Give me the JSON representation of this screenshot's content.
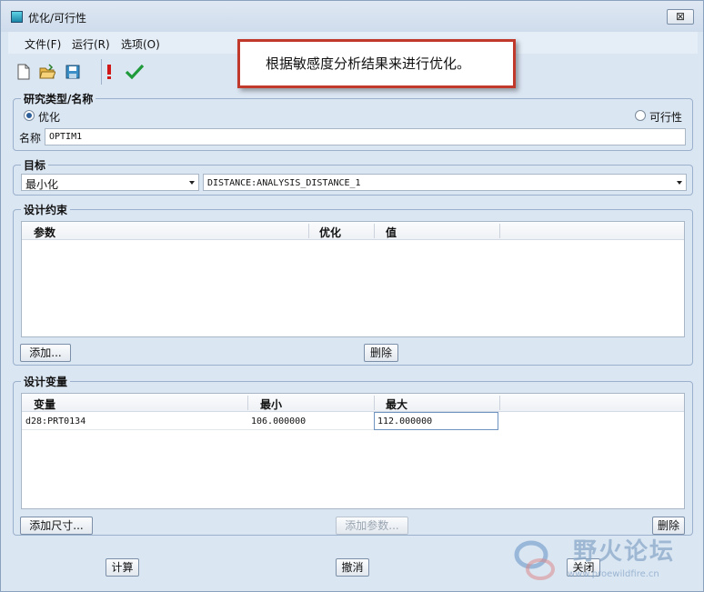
{
  "window": {
    "title": "优化/可行性",
    "close_label": "⊠"
  },
  "menu": [
    "文件(F)",
    "运行(R)",
    "选项(O)"
  ],
  "callout": "根据敏感度分析结果来进行优化。",
  "study": {
    "group_label": "研究类型/名称",
    "option_optimize": "优化",
    "option_feasible": "可行性",
    "selected": "优化",
    "name_label": "名称",
    "name_value": "OPTIM1"
  },
  "goal": {
    "group_label": "目标",
    "mode": "最小化",
    "measure": "DISTANCE:ANALYSIS_DISTANCE_1"
  },
  "constraints": {
    "group_label": "设计约束",
    "columns": [
      "参数",
      "优化",
      "值"
    ],
    "rows": [],
    "add_button": "添加...",
    "delete_button": "删除"
  },
  "variables": {
    "group_label": "设计变量",
    "columns": [
      "变量",
      "最小",
      "最大"
    ],
    "rows": [
      {
        "variable": "d28:PRT0134",
        "min": "106.000000",
        "max": "112.000000"
      }
    ],
    "add_dim_button": "添加尺寸...",
    "add_param_button": "添加参数...",
    "delete_button": "删除"
  },
  "footer": {
    "compute": "计算",
    "cancel": "撤消",
    "close": "关闭"
  },
  "watermark": {
    "cn": "野火论坛",
    "url": "www.proewildfire.cn"
  },
  "colors": {
    "accent": "#2d5f9a",
    "callout_border": "#c0392b",
    "check": "#1f9a3a",
    "exclaim": "#d01818"
  }
}
